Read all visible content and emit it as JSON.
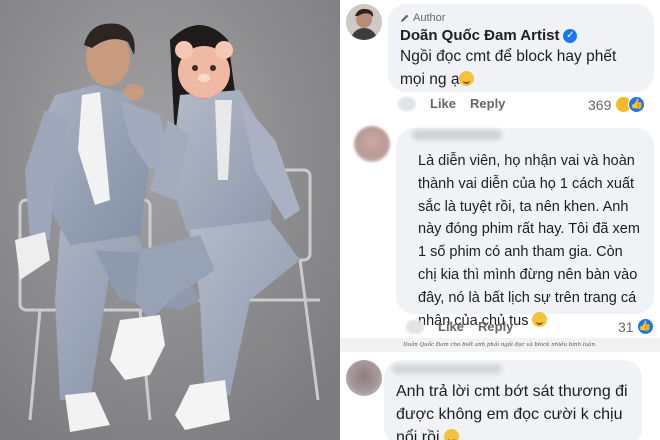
{
  "photo": {
    "alt_subject": "couple-photo",
    "background_color": "#8f8f91",
    "suit_color": "#9aa3b4"
  },
  "comment_author": {
    "badge_label": "Author",
    "name": "Doãn Quốc Đam Artist",
    "text": "Ngồi đọc cmt để block hay phết mọi ng ạ",
    "like_label": "Like",
    "reply_label": "Reply",
    "reaction_count": "369"
  },
  "comment_2": {
    "text": "Là diễn viên, họ nhận vai và hoàn thành vai diễn của họ 1 cách xuất sắc là tuyệt rồi, ta nên khen. Anh này đóng phim rất hay. Tôi đã xem 1 số phim có anh tham gia. Còn chị kia thì mình đừng nên bàn vào đây, nó là bất lịch sự trên trang cá nhân của chủ tus",
    "like_label": "Like",
    "reply_label": "Reply",
    "reaction_count": "31"
  },
  "caption": "Doãn Quốc Đam cho biết anh phải ngồi đọc và block nhiều bình luận.",
  "comment_3": {
    "text": "Anh trả lời cmt bớt sát thương đi được không em đọc cười k chịu nổi rồi"
  },
  "colors": {
    "bubble": "#f0f2f5",
    "accent": "#1877f2",
    "muted_text": "#65676b",
    "primary_text": "#1c1e21"
  },
  "icons": [
    "pen-icon",
    "verified-badge-icon",
    "haha-reaction-icon",
    "like-reaction-icon",
    "smile-emoji-icon"
  ]
}
